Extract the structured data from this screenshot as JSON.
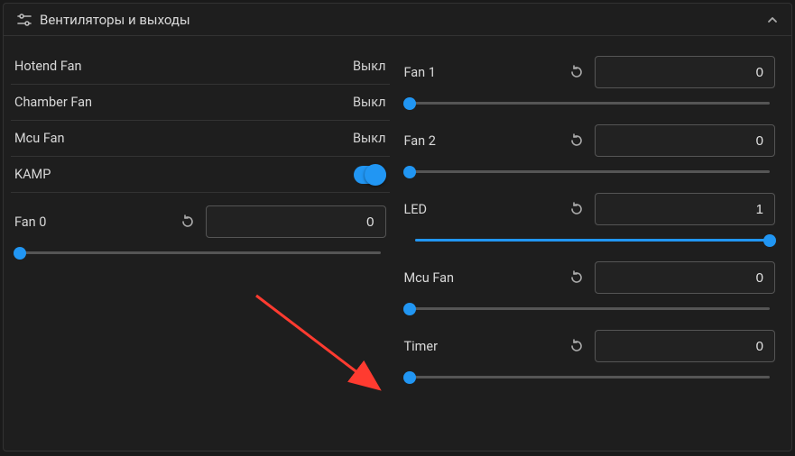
{
  "header": {
    "title": "Вентиляторы и выходы"
  },
  "left": {
    "hotend_fan": {
      "label": "Hotend Fan",
      "status": "Выкл"
    },
    "chamber_fan": {
      "label": "Chamber Fan",
      "status": "Выкл"
    },
    "mcu_fan": {
      "label": "Mcu Fan",
      "status": "Выкл"
    },
    "kamp": {
      "label": "KAMP",
      "on": true
    },
    "fan0": {
      "label": "Fan 0",
      "value": "0",
      "fill_pct": 0
    }
  },
  "right": {
    "fan1": {
      "label": "Fan 1",
      "value": "0",
      "fill_pct": 0
    },
    "fan2": {
      "label": "Fan 2",
      "value": "0",
      "fill_pct": 0
    },
    "led": {
      "label": "LED",
      "value": "1",
      "fill_pct": 100
    },
    "mcu_fan": {
      "label": "Mcu Fan",
      "value": "0",
      "fill_pct": 0
    },
    "timer": {
      "label": "Timer",
      "value": "0",
      "fill_pct": 0
    }
  },
  "colors": {
    "accent": "#2196f3",
    "arrow": "#ff3b30"
  }
}
